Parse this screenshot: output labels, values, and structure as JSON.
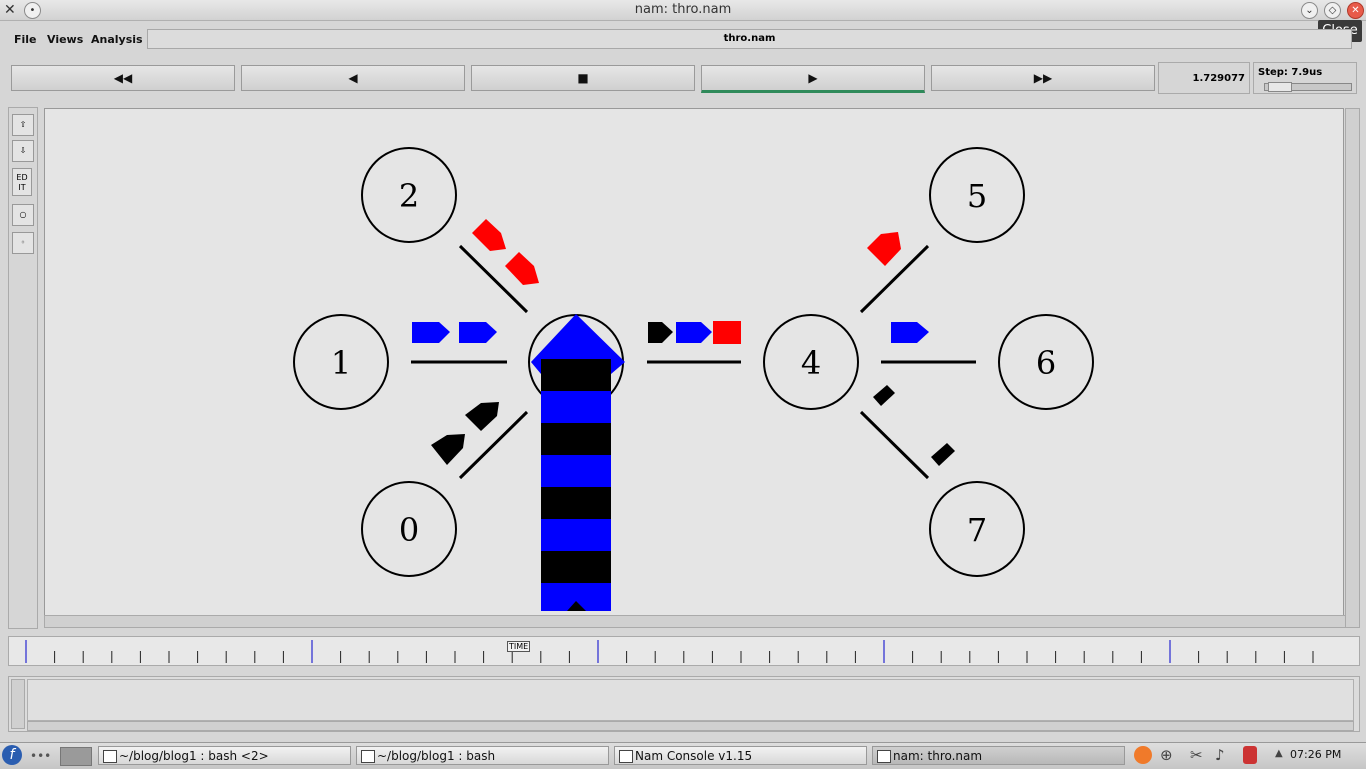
{
  "window": {
    "title": "nam: thro.nam",
    "close_tooltip": "Close"
  },
  "menu": {
    "file": "File",
    "views": "Views",
    "analysis": "Analysis",
    "file_title": "thro.nam"
  },
  "controls": {
    "rewind": "◀◀",
    "back": "◀",
    "stop": "■",
    "play": "▶",
    "fast_forward": "▶▶",
    "time": "1.729077",
    "step": "Step: 7.9us"
  },
  "tools": {
    "edit": "ED IT"
  },
  "nodes": [
    {
      "id": "0",
      "label": "0"
    },
    {
      "id": "1",
      "label": "1"
    },
    {
      "id": "2",
      "label": "2"
    },
    {
      "id": "3",
      "label": ""
    },
    {
      "id": "4",
      "label": "4"
    },
    {
      "id": "5",
      "label": "5"
    },
    {
      "id": "6",
      "label": "6"
    },
    {
      "id": "7",
      "label": "7"
    }
  ],
  "timeline": {
    "label": "TIME"
  },
  "taskbar": {
    "tasks": [
      "~/blog/blog1 : bash <2>",
      "~/blog/blog1 : bash",
      "Nam Console v1.15",
      "nam: thro.nam"
    ],
    "clock": "07:26 PM"
  },
  "colors": {
    "queue_blue": "#0000ff",
    "queue_black": "#000000",
    "packet_red": "#ff0000",
    "play_indicator": "#2f8a5a"
  }
}
